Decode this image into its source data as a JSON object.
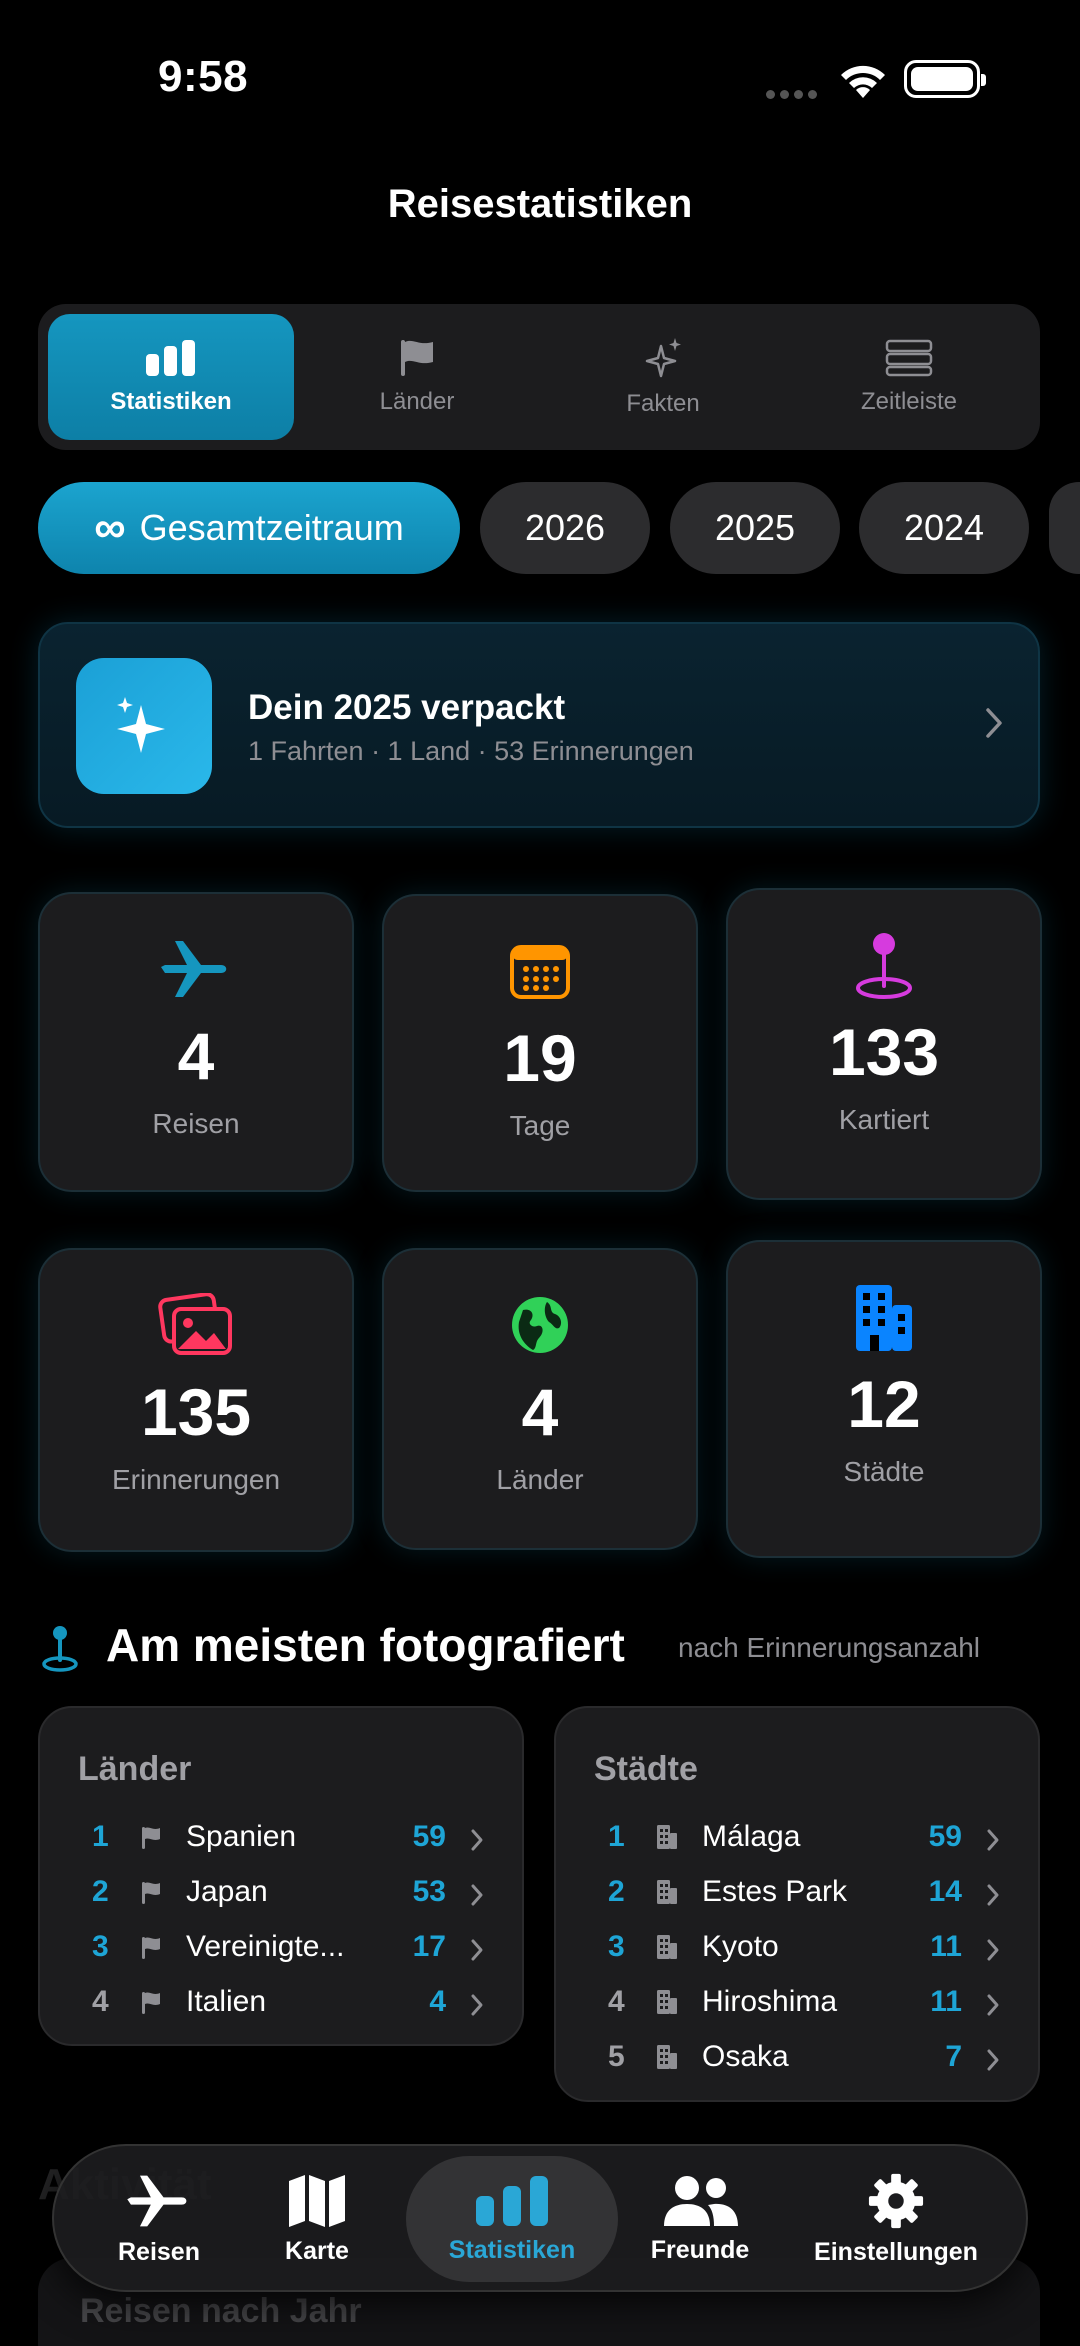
{
  "status": {
    "time": "9:58"
  },
  "nav": {
    "title": "Reisestatistiken"
  },
  "segments": [
    {
      "label": "Statistiken",
      "icon": "bar-chart-icon",
      "active": true
    },
    {
      "label": "Länder",
      "icon": "flag-icon",
      "active": false
    },
    {
      "label": "Fakten",
      "icon": "sparkles-icon",
      "active": false
    },
    {
      "label": "Zeitleiste",
      "icon": "timeline-icon",
      "active": false
    }
  ],
  "periods": [
    {
      "label": "Gesamtzeitraum",
      "icon": "infinity-icon",
      "active": true
    },
    {
      "label": "2026",
      "active": false
    },
    {
      "label": "2025",
      "active": false
    },
    {
      "label": "2024",
      "active": false
    }
  ],
  "wrapped": {
    "title": "Dein 2025 verpackt",
    "subtitle": "1 Fahrten · 1 Land · 53 Erinnerungen"
  },
  "stats": [
    {
      "value": "4",
      "label": "Reisen",
      "icon": "airplane-icon",
      "color": "#1596bf"
    },
    {
      "value": "19",
      "label": "Tage",
      "icon": "calendar-icon",
      "color": "#ff9500"
    },
    {
      "value": "133",
      "label": "Kartiert",
      "icon": "map-pin-icon",
      "color": "#d63bde"
    },
    {
      "value": "135",
      "label": "Erinnerungen",
      "icon": "photos-icon",
      "color": "#ff375f"
    },
    {
      "value": "4",
      "label": "Länder",
      "icon": "globe-icon",
      "color": "#30d158"
    },
    {
      "value": "12",
      "label": "Städte",
      "icon": "buildings-icon",
      "color": "#0a84ff"
    }
  ],
  "most_photographed": {
    "title": "Am meisten fotografiert",
    "subtitle": "nach Erinnerungsanzahl",
    "countries": {
      "title": "Länder",
      "items": [
        {
          "rank": "1",
          "name": "Spanien",
          "count": "59"
        },
        {
          "rank": "2",
          "name": "Japan",
          "count": "53"
        },
        {
          "rank": "3",
          "name": "Vereinigte...",
          "count": "17"
        },
        {
          "rank": "4",
          "name": "Italien",
          "count": "4"
        }
      ]
    },
    "cities": {
      "title": "Städte",
      "items": [
        {
          "rank": "1",
          "name": "Málaga",
          "count": "59"
        },
        {
          "rank": "2",
          "name": "Estes Park",
          "count": "14"
        },
        {
          "rank": "3",
          "name": "Kyoto",
          "count": "11"
        },
        {
          "rank": "4",
          "name": "Hiroshima",
          "count": "11"
        },
        {
          "rank": "5",
          "name": "Osaka",
          "count": "7"
        }
      ]
    }
  },
  "faded": {
    "title": "Aktivität",
    "subtitle": "Reisen nach Jahr"
  },
  "tabbar": [
    {
      "label": "Reisen",
      "icon": "airplane-icon",
      "active": false
    },
    {
      "label": "Karte",
      "icon": "map-icon",
      "active": false
    },
    {
      "label": "Statistiken",
      "icon": "bar-chart-icon",
      "active": true
    },
    {
      "label": "Freunde",
      "icon": "people-icon",
      "active": false
    },
    {
      "label": "Einstellungen",
      "icon": "gear-icon",
      "active": false
    }
  ],
  "colors": {
    "accent": "#1596bf",
    "count": "#1ea5d6",
    "background": "#000000",
    "card": "#1c1c1e"
  }
}
